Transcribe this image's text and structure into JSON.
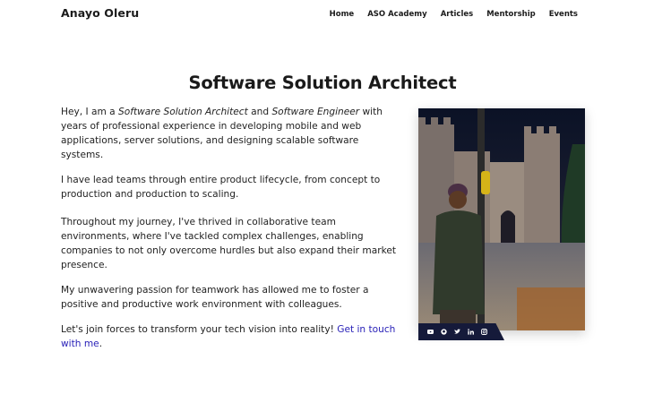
{
  "header": {
    "brand": "Anayo Oleru",
    "nav": [
      "Home",
      "ASO Academy",
      "Articles",
      "Mentorship",
      "Events"
    ]
  },
  "main": {
    "title": "Software Solution Architect",
    "p1": {
      "a": "Hey, I am a ",
      "b": "Software Solution Architect",
      "c": " and ",
      "d": "Software Engineer",
      "e": " with years of professional experience in developing mobile and web applications, server solutions, and designing scalable software systems."
    },
    "p2": "I have lead teams through entire product lifecycle, from concept to production and production to scaling.",
    "p3": "Throughout my journey, I've thrived in collaborative team environments, where I've tackled complex challenges, enabling companies to not only overcome hurdles but also expand their market presence.",
    "p4": "My unwavering passion for teamwork has allowed me to foster a positive and productive work environment with colleagues.",
    "p5": {
      "text": "Let's join forces to transform your tech vision into reality! ",
      "link": "Get in touch with me",
      "end": "."
    }
  },
  "social": {
    "icons": [
      "youtube-icon",
      "github-icon",
      "twitter-icon",
      "linkedin-icon",
      "instagram-icon"
    ]
  },
  "colors": {
    "link": "#2a22b8",
    "social_bar": "#151a3a",
    "text": "#222222"
  }
}
